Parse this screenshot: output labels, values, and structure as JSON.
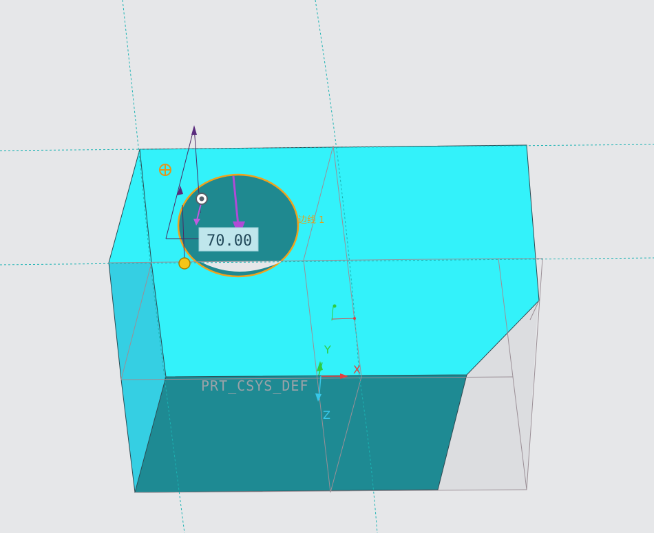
{
  "viewport": {
    "title": "",
    "colors": {
      "background": "#e6e7e9",
      "top_face": "#33f2fa",
      "front_face": "#35cfe3",
      "bottom_face": "#1e8a93",
      "hole_fill": "#1f8990",
      "hole_outline": "#f0a21c",
      "datum_plane": "#1cb3b3",
      "drag_arrow": "#b04ad6",
      "ghost_face": "#dcdde0",
      "x_axis": "#e04040",
      "y_axis": "#2ecc40",
      "z_axis": "#38c7e8"
    }
  },
  "hole_feature": {
    "diameter_value": "70.00",
    "edge_reference_label": "边线 1",
    "handle_icons": [
      "anchor-handle-icon",
      "center-handle-icon",
      "placement-handle-icon"
    ]
  },
  "csys": {
    "name": "PRT_CSYS_DEF",
    "x_label": "X",
    "y_label": "Y",
    "z_label": "Z"
  }
}
